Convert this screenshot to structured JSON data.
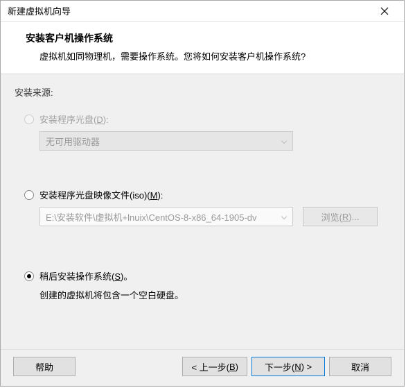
{
  "window": {
    "title": "新建虚拟机向导"
  },
  "header": {
    "title": "安装客户机操作系统",
    "description": "虚拟机如同物理机，需要操作系统。您将如何安装客户机操作系统?"
  },
  "content": {
    "source_label": "安装来源:",
    "option1": {
      "label_prefix": "安装程序光盘(",
      "hotkey": "D",
      "label_suffix": "):",
      "combo_value": "无可用驱动器"
    },
    "option2": {
      "label_prefix": "安装程序光盘映像文件(iso)(",
      "hotkey": "M",
      "label_suffix": "):",
      "iso_path": "E:\\安装软件\\虚拟机+lnuix\\CentOS-8-x86_64-1905-dv",
      "browse_prefix": "浏览(",
      "browse_hotkey": "R",
      "browse_suffix": ")..."
    },
    "option3": {
      "label_prefix": "稍后安装操作系统(",
      "hotkey": "S",
      "label_suffix": ")。",
      "description": "创建的虚拟机将包含一个空白硬盘。"
    }
  },
  "footer": {
    "help": "帮助",
    "back_prefix": "< 上一步(",
    "back_hotkey": "B",
    "back_suffix": ")",
    "next_prefix": "下一步(",
    "next_hotkey": "N",
    "next_suffix": ") >",
    "cancel": "取消"
  }
}
